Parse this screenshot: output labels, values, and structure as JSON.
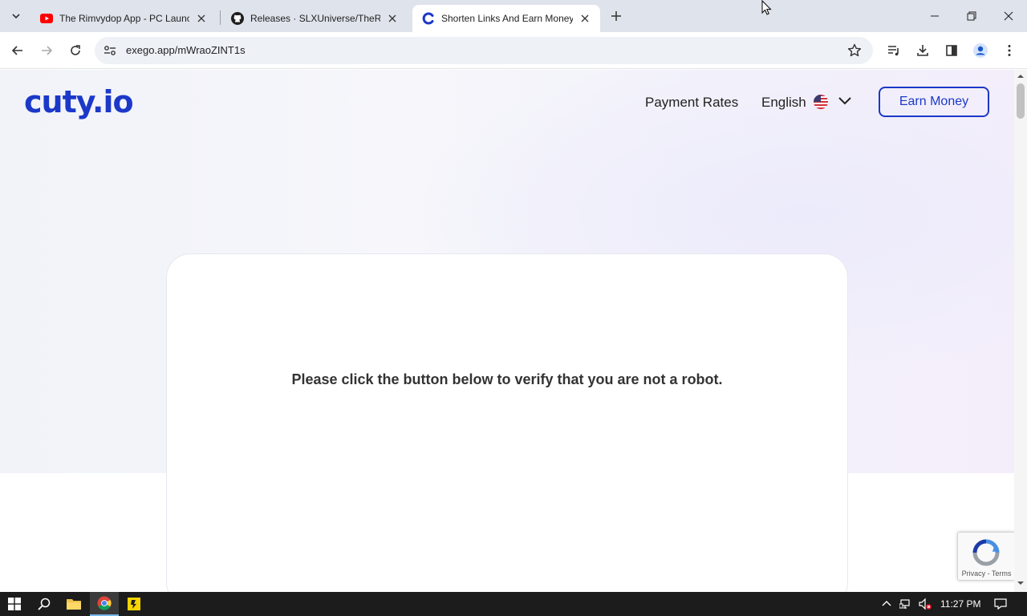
{
  "browser": {
    "tabs": [
      {
        "title": "The Rimvydop App - PC Launch",
        "favicon": "youtube-icon",
        "active": false
      },
      {
        "title": "Releases · SLXUniverse/TheRimv",
        "favicon": "github-icon",
        "active": false
      },
      {
        "title": "Shorten Links And Earn Money |",
        "favicon": "cuty-icon",
        "active": true
      }
    ],
    "url": "exego.app/mWraoZINT1s"
  },
  "site": {
    "logo": "cuty.io",
    "nav": {
      "payment_rates": "Payment Rates",
      "language": "English",
      "earn_money": "Earn Money"
    },
    "verify_message": "Please click the button below to verify that you are not a robot.",
    "recaptcha": {
      "links": "Privacy - Terms"
    }
  },
  "taskbar": {
    "time": "11:27 PM",
    "apps": [
      "start-icon",
      "search-icon",
      "file-explorer-icon",
      "chrome-icon",
      "app-icon"
    ]
  },
  "colors": {
    "brand_blue": "#1b38c9",
    "tabstrip": "#dfe3eb",
    "taskbar": "#1c1c1c"
  }
}
